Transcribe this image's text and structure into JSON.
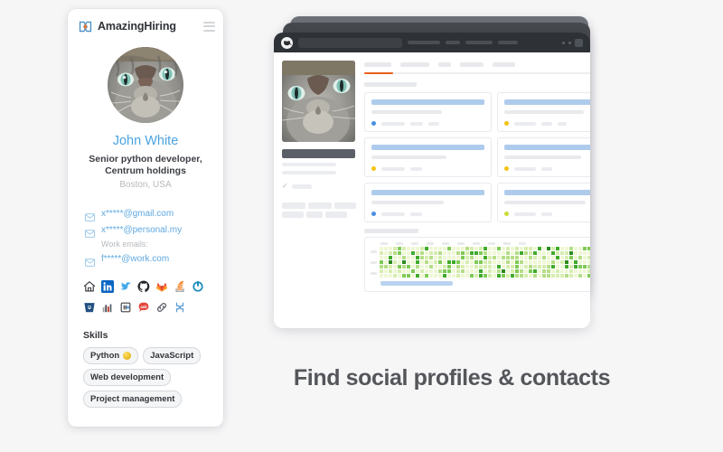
{
  "colors": {
    "page_background": "#f6f6f7",
    "brand_blue": "#4aa3df",
    "accent_orange": "#e8601c",
    "logo_blue": "#4a90c4",
    "logo_orange": "#e8742a",
    "headline_gray": "#54565a",
    "heat_green": "#2aa02a"
  },
  "extension_card": {
    "header": {
      "brand": "AmazingHiring",
      "logo_icon": "amazinghiring-logo-icon",
      "menu_icon": "hamburger-menu-icon"
    },
    "avatar": {
      "icon": "user-avatar-cat-photo",
      "alt": "Profile photo of a gray tabby cat"
    },
    "person": {
      "name": "John White",
      "title": "Senior python developer,",
      "company": "Centrum holdings",
      "location": "Boston, USA"
    },
    "emails": {
      "personal": [
        {
          "icon": "envelope-icon",
          "address": "x*****@gmail.com"
        },
        {
          "icon": "envelope-icon",
          "address": "x*****@personal.my"
        }
      ],
      "work_label": "Work emails:",
      "work": [
        {
          "icon": "envelope-icon",
          "address": "f*****@work.com"
        }
      ]
    },
    "social_links": [
      {
        "icon": "home-icon",
        "label": "Personal website"
      },
      {
        "icon": "linkedin-icon",
        "label": "LinkedIn"
      },
      {
        "icon": "twitter-icon",
        "label": "Twitter"
      },
      {
        "icon": "github-icon",
        "label": "GitHub"
      },
      {
        "icon": "gitlab-icon",
        "label": "GitLab"
      },
      {
        "icon": "stackoverflow-icon",
        "label": "Stack Overflow"
      },
      {
        "icon": "gravatar-icon",
        "label": "Gravatar"
      },
      {
        "icon": "bitbucket-icon",
        "label": "Bitbucket"
      },
      {
        "icon": "kaggle-icon",
        "label": "Kaggle"
      },
      {
        "icon": "habr-icon",
        "label": "Habr"
      },
      {
        "icon": "askfm-icon",
        "label": "Ask"
      },
      {
        "icon": "link-icon",
        "label": "Other link"
      },
      {
        "icon": "behance-icon",
        "label": "Behance"
      }
    ],
    "skills": {
      "heading": "Skills",
      "items": [
        {
          "label": "Python",
          "badge": "gold-medal-icon"
        },
        {
          "label": "JavaScript",
          "badge": null
        },
        {
          "label": "Web development",
          "badge": null
        },
        {
          "label": "Project management",
          "badge": null
        }
      ]
    }
  },
  "browser_mock": {
    "favicon_icon": "cat-favicon-icon",
    "window_controls_icon": "window-controls-icon",
    "tab_count": 3,
    "active_tab_index": 0,
    "heatmap": {
      "type": "contribution-heatmap",
      "columns": 53,
      "rows": 7,
      "palette": [
        "#eef7d4",
        "#d7edb0",
        "#b5dd87",
        "#7fca55",
        "#3faa2b",
        "#2a8b1e"
      ]
    }
  },
  "headline": {
    "text": "Find social profiles & contacts"
  }
}
